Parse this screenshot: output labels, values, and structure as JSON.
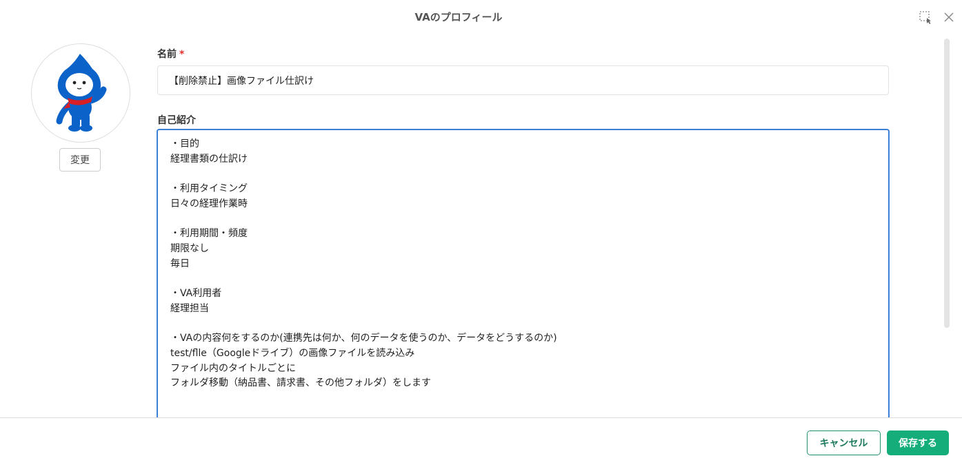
{
  "dialog": {
    "title": "VAのプロフィール"
  },
  "avatar": {
    "change_label": "変更"
  },
  "name_field": {
    "label": "名前",
    "required_mark": "*",
    "value": "【削除禁止】画像ファイル仕訳け"
  },
  "bio_field": {
    "label": "自己紹介",
    "value": "・目的\n経理書類の仕訳け\n\n・利用タイミング\n日々の経理作業時\n\n・利用期間・頻度\n期限なし\n毎日\n\n・VA利用者\n経理担当\n\n・VAの内容何をするのか(連携先は何か、何のデータを使うのか、データをどうするのか)\ntest/flle（Googleドライブ）の画像ファイルを読み込み\nファイル内のタイトルごとに\nフォルダ移動（納品書、請求書、その他フォルダ）をします"
  },
  "footer": {
    "cancel_label": "キャンセル",
    "save_label": "保存する"
  },
  "colors": {
    "accent": "#15ad7a",
    "focus": "#3b7fd6",
    "required": "#e0302a"
  }
}
